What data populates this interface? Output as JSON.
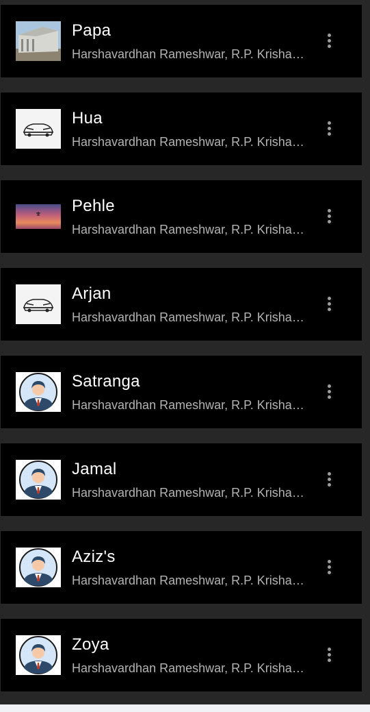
{
  "colors": {
    "background": "#272727",
    "row": "#000000",
    "title": "#ffffff",
    "subtitle": "#b3b3b3",
    "menu_dots": "#9e9e9e"
  },
  "songs": [
    {
      "title": "Papa",
      "artists": "Harshavardhan Rameshwar, R.P. Krishang, Raghav Chaitanya, Aseem Mathur",
      "art": "building-thumbnail",
      "menu_icon": "more-vertical-icon"
    },
    {
      "title": "Hua",
      "artists": "Harshavardhan Rameshwar, R.P. Krishang, Raghav Chaitanya, Aseem Mathur",
      "art": "car-sketch-thumbnail",
      "menu_icon": "more-vertical-icon"
    },
    {
      "title": "Pehle",
      "artists": "Harshavardhan Rameshwar, R.P. Krishang, Raghav Chaitanya, Aseem Mathur",
      "art": "sunset-plane-thumbnail",
      "menu_icon": "more-vertical-icon"
    },
    {
      "title": "Arjan",
      "artists": "Harshavardhan Rameshwar, R.P. Krishang, Raghav Chaitanya, Aseem Mathur",
      "art": "car-sketch-thumbnail",
      "menu_icon": "more-vertical-icon"
    },
    {
      "title": "Satranga",
      "artists": "Harshavardhan Rameshwar, R.P. Krishang, Raghav Chaitanya, Aseem Mathur",
      "art": "person-avatar-thumbnail",
      "menu_icon": "more-vertical-icon"
    },
    {
      "title": "Jamal",
      "artists": "Harshavardhan Rameshwar, R.P. Krishang, Raghav Chaitanya, Aseem Mathur",
      "art": "person-avatar-thumbnail",
      "menu_icon": "more-vertical-icon"
    },
    {
      "title": "Aziz's",
      "artists": "Harshavardhan Rameshwar, R.P. Krishang, Raghav Chaitanya, Aseem Mathur",
      "art": "person-avatar-thumbnail",
      "menu_icon": "more-vertical-icon"
    },
    {
      "title": "Zoya",
      "artists": "Harshavardhan Rameshwar, R.P. Krishang, Raghav Chaitanya, Aseem Mathur",
      "art": "person-avatar-thumbnail",
      "menu_icon": "more-vertical-icon"
    }
  ]
}
